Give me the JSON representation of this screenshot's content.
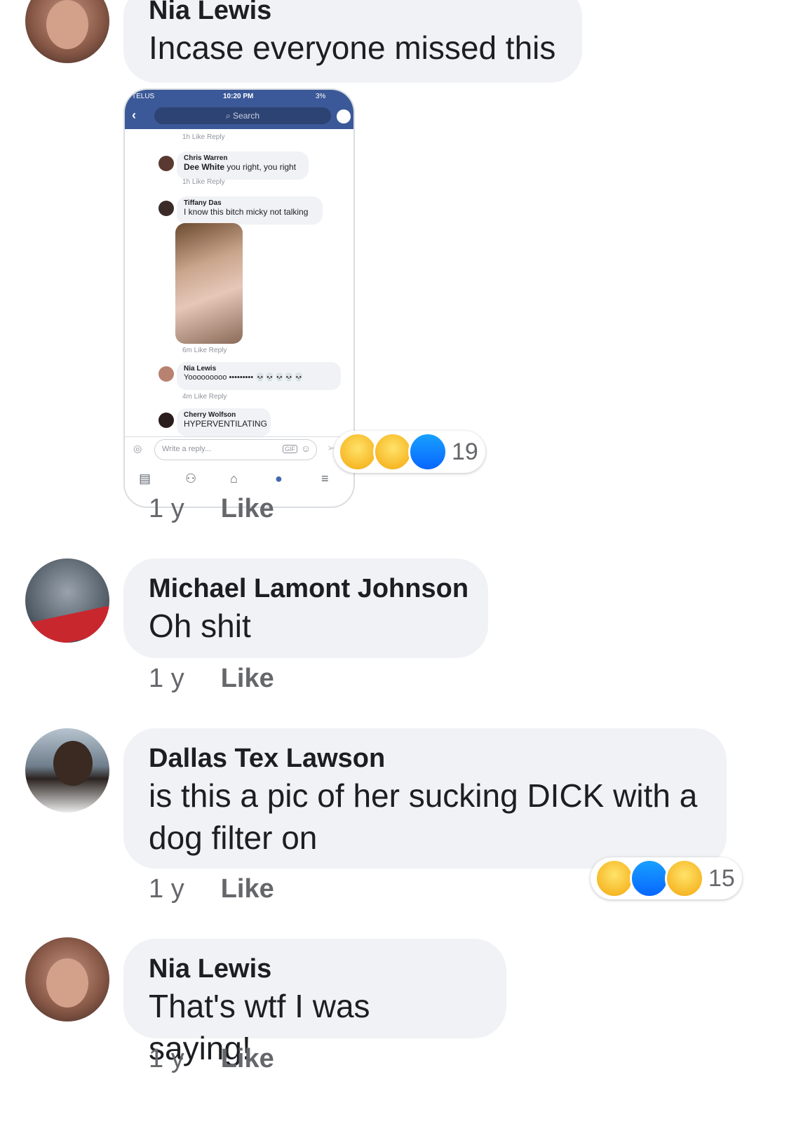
{
  "colors": {
    "bubble": "#f0f2f5",
    "meta": "#65676b",
    "fb_blue": "#3b5998"
  },
  "comments": [
    {
      "name": "Nia Lewis",
      "text": "Incase everyone missed this",
      "time": "1 y",
      "like": "Like",
      "reaction_count": "19",
      "reactions": [
        "haha-icon",
        "wow-icon",
        "like-icon"
      ]
    },
    {
      "name": "Michael Lamont Johnson",
      "text": "Oh shit",
      "time": "1 y",
      "like": "Like"
    },
    {
      "name": "Dallas Tex Lawson",
      "text": "is this a pic of her sucking DICK with a dog filter on",
      "time": "1 y",
      "like": "Like",
      "reaction_count": "15",
      "reactions": [
        "haha-icon",
        "like-icon",
        "wow-icon"
      ]
    },
    {
      "name": "Nia Lewis",
      "text": "That's wtf I was saying!",
      "time": "1 y",
      "like": "Like"
    }
  ],
  "screenshot": {
    "carrier": "TELUS",
    "clock": "10:20 PM",
    "battery": "3%",
    "search": "Search",
    "meta1": "1h   Like   Reply",
    "c1": {
      "name": "Chris Warren",
      "tag": "Dee White",
      "text": " you right, you right",
      "meta": "1h   Like   Reply"
    },
    "c2": {
      "name": "Tiffany Das",
      "text": "I know this bitch micky not talking",
      "meta": "6m   Like   Reply"
    },
    "c3": {
      "name": "Nia Lewis",
      "text": "Yooooooooo ••••••••• 💀💀💀💀💀",
      "meta": "4m   Like   Reply"
    },
    "c4": {
      "name": "Cherry Wolfson",
      "text": "HYPERVENTILATING"
    },
    "reply_placeholder": "Write a reply...",
    "gif": "GIF"
  }
}
